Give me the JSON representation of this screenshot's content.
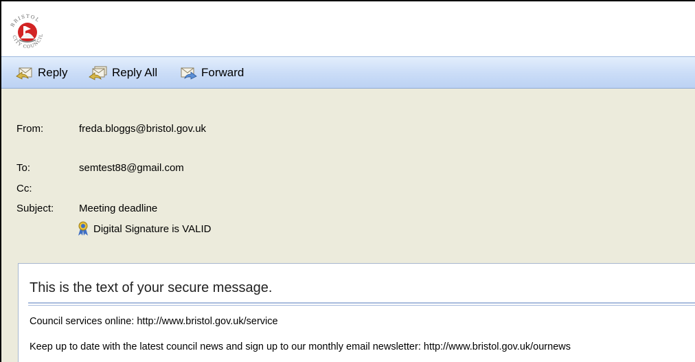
{
  "logo": {
    "name": "Bristol City Council crest",
    "text_top": "BRISTOL",
    "text_bottom": "CITY COUNCIL"
  },
  "toolbar": {
    "reply_label": "Reply",
    "reply_all_label": "Reply All",
    "forward_label": "Forward"
  },
  "headers": {
    "from_label": "From:",
    "from_value": "freda.bloggs@bristol.gov.uk",
    "to_label": "To:",
    "to_value": "semtest88@gmail.com",
    "cc_label": "Cc:",
    "cc_value": "",
    "subject_label": "Subject:",
    "subject_value": "Meeting deadline",
    "signature_status": "Digital Signature is VALID"
  },
  "message": {
    "title": "This is the text of your secure message.",
    "lines": [
      "Council services online: http://www.bristol.gov.uk/service",
      "Keep up to date with the latest council news and sign up to our monthly email newsletter: http://www.bristol.gov.uk/ournews"
    ]
  },
  "colors": {
    "toolbar_bg": "#cadcf7",
    "header_bg": "#ecebdc",
    "rule": "#a8bbdc",
    "logo_red": "#d22424"
  },
  "icons": [
    "reply-icon",
    "reply-all-icon",
    "forward-icon",
    "ribbon-badge-icon"
  ]
}
